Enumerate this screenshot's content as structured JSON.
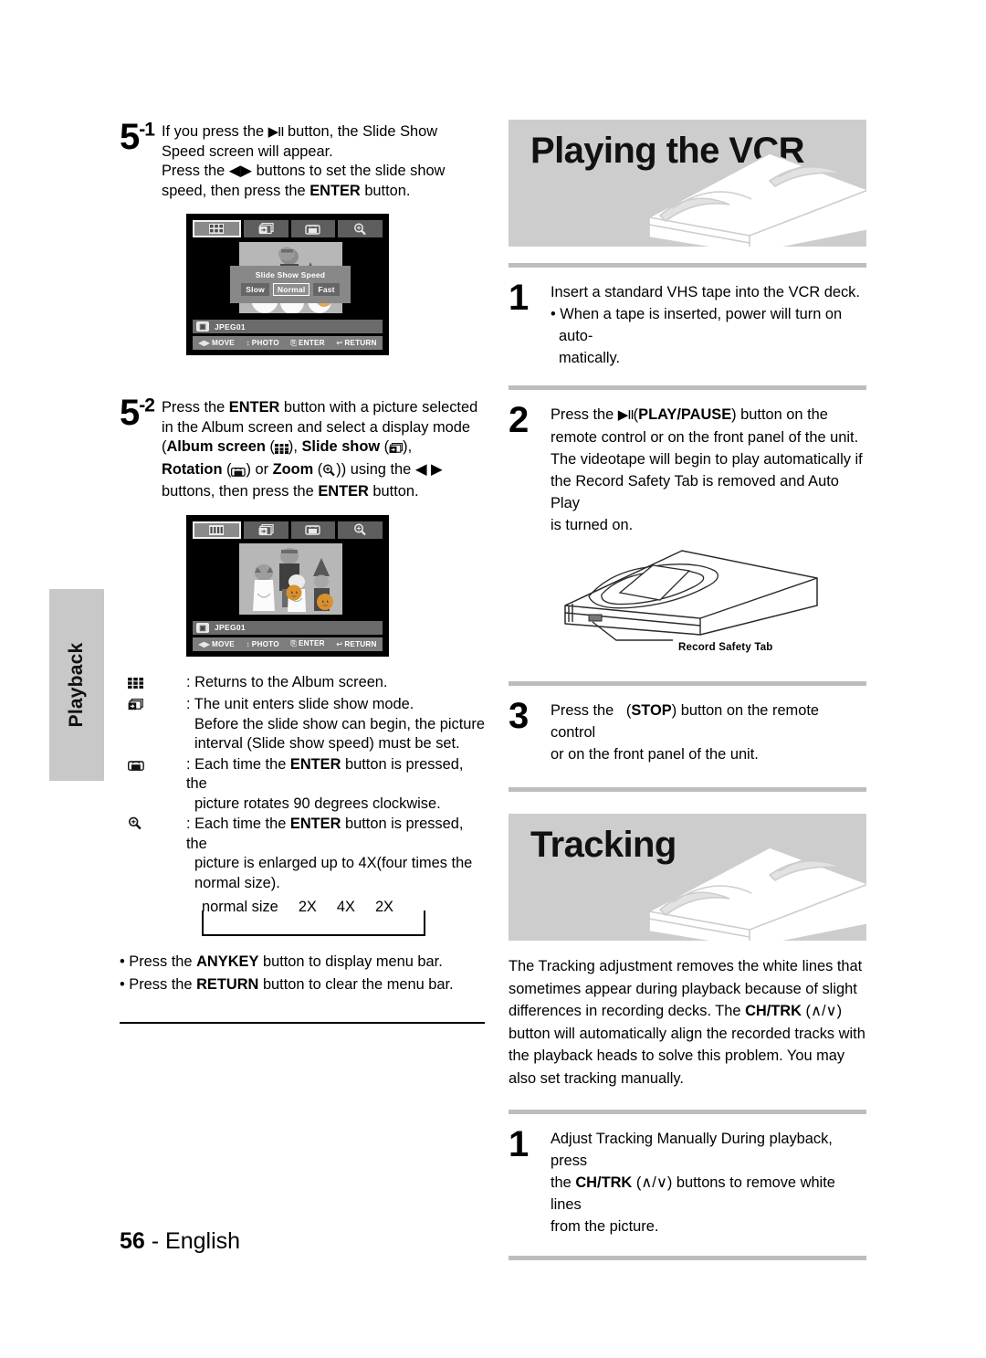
{
  "page": {
    "number": "56",
    "language": "English",
    "side_tab": "Playback"
  },
  "left_column": {
    "step_5_1": {
      "num": "5",
      "sup": "-1",
      "lines": [
        "If you press the ▶II button, the Slide Show",
        "Speed screen will appear.",
        "Press the ◀ ▶ buttons to set the slide show",
        "speed, then press the ENTER button."
      ],
      "bold_terms": [
        "ENTER"
      ]
    },
    "osd_slideshow": {
      "toolbar_icons": [
        "album-screen-icon",
        "slide-show-icon",
        "rotation-icon",
        "zoom-icon"
      ],
      "selected_index": 0,
      "dialog": {
        "title": "Slide Show Speed",
        "options": [
          "Slow",
          "Normal",
          "Fast"
        ],
        "selected": "Normal"
      },
      "file_name": "JPEG01",
      "legend": [
        "MOVE",
        "PHOTO",
        "ENTER",
        "RETURN"
      ]
    },
    "step_5_2": {
      "num": "5",
      "sup": "-2",
      "line1": "Press the ENTER button with a picture selected",
      "line2": "in the Album screen and select a display mode",
      "line3_a": "(",
      "line3_b": "Album screen",
      "line3_c": " (",
      "line3_d": "), ",
      "line3_e": "Slide show",
      "line3_f": " (",
      "line3_g": "),",
      "line4_a": "Rotation",
      "line4_b": " (",
      "line4_c": ") or ",
      "line4_d": "Zoom",
      "line4_e": " (",
      "line4_f": ")) using the ◀ ▶",
      "line5": "buttons, then press the ENTER button."
    },
    "osd_album": {
      "toolbar_icons": [
        "album-screen-icon",
        "slide-show-icon",
        "rotation-icon",
        "zoom-icon"
      ],
      "selected_index": 0,
      "file_name": "JPEG01",
      "legend": [
        "MOVE",
        "PHOTO",
        "ENTER",
        "RETURN"
      ]
    },
    "key_list": [
      {
        "icon": "album-screen-icon",
        "text": ": Returns to the Album screen.",
        "continuation": []
      },
      {
        "icon": "slide-show-icon",
        "text": ": The unit enters slide show mode.",
        "continuation": [
          "Before the slide show can begin, the picture",
          "interval (Slide show speed) must be set."
        ]
      },
      {
        "icon": "rotation-icon",
        "text": ": Each time the ENTER button is pressed, the",
        "continuation": [
          "picture rotates 90 degrees clockwise."
        ]
      },
      {
        "icon": "zoom-icon",
        "text": ": Each time the ENTER button is pressed, the",
        "continuation": [
          "picture is enlarged up to 4X(four times the",
          "normal size)."
        ]
      }
    ],
    "zoom_sequence": [
      "normal size",
      "2X",
      "4X",
      "2X"
    ],
    "notes": [
      "Press the ANYKEY button to display menu bar.",
      "Press the RETURN button to clear the menu bar."
    ]
  },
  "right_column": {
    "banner_playing": {
      "title": "Playing the VCR",
      "graphic": "vhs-tape-illustration"
    },
    "playing_steps": [
      {
        "num": "1",
        "lines": [
          "Insert a standard VHS tape into the VCR deck.",
          "• When a tape is inserted, power will turn on auto-",
          "matically."
        ]
      },
      {
        "num": "2",
        "lines": [
          "Press the  ▶II(PLAY/PAUSE) button on the",
          "remote control or on the front panel of the unit.",
          "The videotape will begin to play automatically if",
          "the Record Safety Tab is removed and Auto Play",
          "is turned on."
        ]
      },
      {
        "num": "3",
        "lines": [
          "Press the  (STOP) button on the remote control",
          "or on the front panel of the unit."
        ]
      }
    ],
    "tape_figure": {
      "label": "Record Safety Tab",
      "graphic": "vhs-cassette-diagram"
    },
    "banner_tracking": {
      "title": "Tracking",
      "graphic": "vhs-tape-illustration"
    },
    "tracking_paragraph": "The Tracking adjustment removes the white lines that sometimes appear during playback because of slight differences in recording decks. The CH/TRK (∧/∨) button will automatically align the recorded tracks with the playback heads to solve this problem. You may also set tracking manually.",
    "tracking_step": {
      "num": "1",
      "lines": [
        "Adjust Tracking Manually  During playback, press",
        "the CH/TRK (∧/∨) buttons to remove white lines",
        "from the picture."
      ]
    }
  }
}
